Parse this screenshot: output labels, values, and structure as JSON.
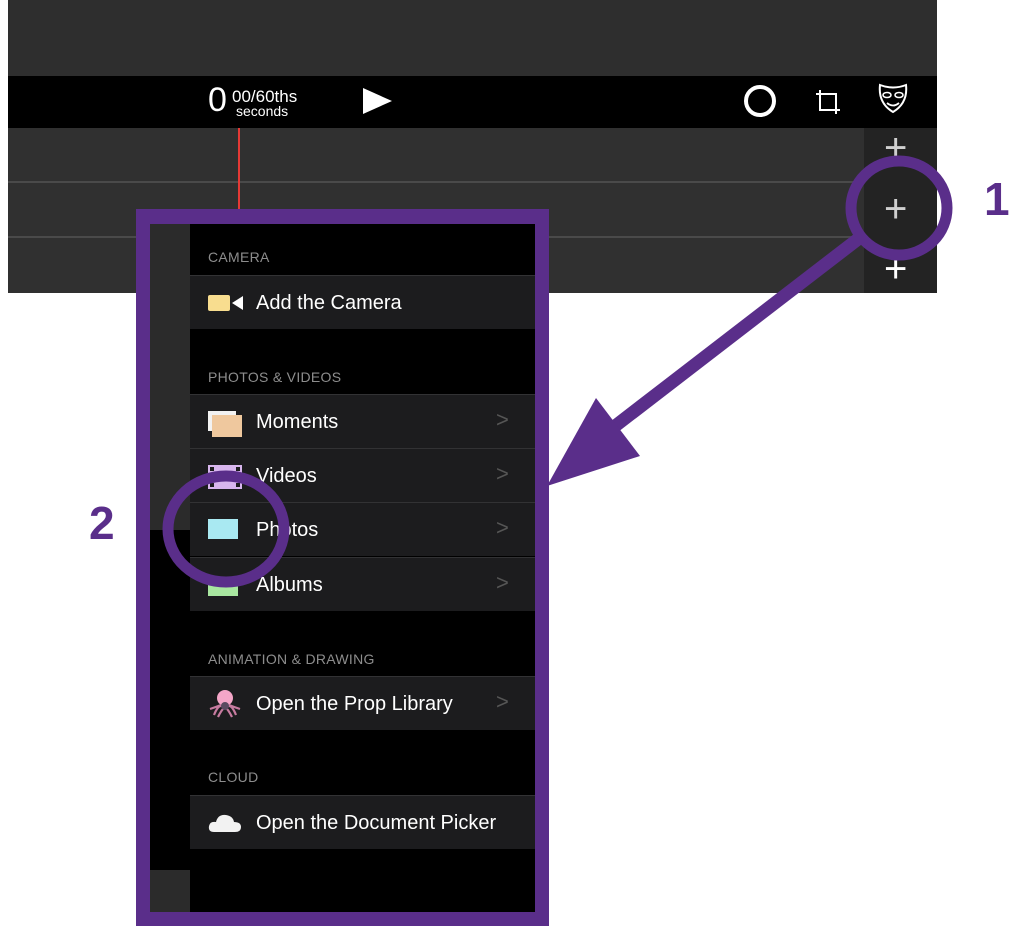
{
  "toolbar": {
    "timer_whole": "0",
    "timer_fraction": "00/60ths",
    "timer_unit": "seconds"
  },
  "track_controls": {
    "add_symbol": "+"
  },
  "menu": {
    "sections": {
      "camera": "CAMERA",
      "photos_videos": "PHOTOS & VIDEOS",
      "animation": "ANIMATION & DRAWING",
      "cloud": "CLOUD"
    },
    "items": {
      "add_camera": "Add the Camera",
      "moments": "Moments",
      "videos": "Videos",
      "photos": "Photos",
      "albums": "Albums",
      "prop_library": "Open the Prop Library",
      "document_picker": "Open the Document Picker"
    },
    "chevron": ">"
  },
  "annotations": {
    "step1": "1",
    "step2": "2"
  },
  "colors": {
    "annotation": "#5a2e8a",
    "playhead": "#e53935"
  }
}
